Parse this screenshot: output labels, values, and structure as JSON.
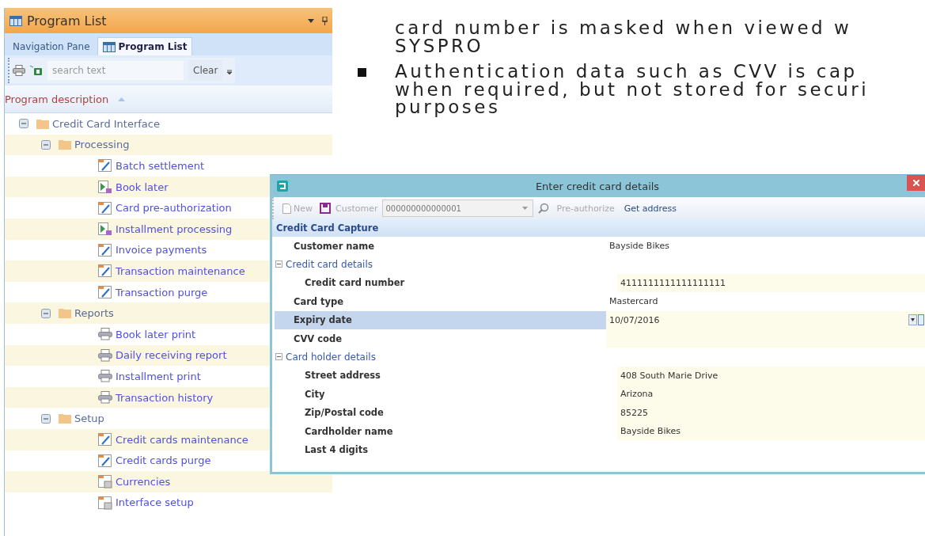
{
  "slide": {
    "bullets": [
      {
        "marker": false,
        "lines": [
          "card number is masked when viewed w",
          "SYSPRO"
        ]
      },
      {
        "marker": true,
        "lines": [
          "Authentication data such as CVV is cap",
          "when required, but not stored for securi",
          "purposes"
        ]
      }
    ]
  },
  "program_list": {
    "title": "Program List",
    "tabs": [
      {
        "label": "Navigation Pane",
        "selected": false,
        "icon": false
      },
      {
        "label": "Program List",
        "selected": true,
        "icon": true
      }
    ],
    "search": {
      "placeholder": "search text"
    },
    "clear_button": "Clear",
    "column": "Program description",
    "tree": [
      {
        "label": "Credit Card Interface",
        "kind": "folder",
        "expanded": true,
        "children": [
          {
            "label": "Processing",
            "kind": "folder",
            "expanded": true,
            "children": [
              {
                "label": "Batch settlement",
                "kind": "form"
              },
              {
                "label": "Book later",
                "kind": "query"
              },
              {
                "label": "Card pre-authorization",
                "kind": "form"
              },
              {
                "label": "Installment processing",
                "kind": "query"
              },
              {
                "label": "Invoice payments",
                "kind": "form"
              },
              {
                "label": "Transaction maintenance",
                "kind": "form"
              },
              {
                "label": "Transaction purge",
                "kind": "form"
              }
            ]
          },
          {
            "label": "Reports",
            "kind": "folder",
            "expanded": true,
            "children": [
              {
                "label": "Book later print",
                "kind": "print"
              },
              {
                "label": "Daily receiving report",
                "kind": "print"
              },
              {
                "label": "Installment print",
                "kind": "print"
              },
              {
                "label": "Transaction history",
                "kind": "print"
              }
            ]
          },
          {
            "label": "Setup",
            "kind": "folder",
            "expanded": true,
            "children": [
              {
                "label": "Credit cards maintenance",
                "kind": "form"
              },
              {
                "label": "Credit cards purge",
                "kind": "form"
              },
              {
                "label": "Currencies",
                "kind": "setup"
              },
              {
                "label": "Interface setup",
                "kind": "setup"
              }
            ]
          }
        ]
      }
    ]
  },
  "dialog": {
    "title": "Enter credit card details",
    "toolbar": [
      {
        "kind": "new",
        "label": "New",
        "disabled": true
      },
      {
        "kind": "save"
      },
      {
        "kind": "label",
        "label": "Customer",
        "disabled": true
      },
      {
        "kind": "combo",
        "value": "000000000000001"
      },
      {
        "kind": "search"
      },
      {
        "kind": "button",
        "label": "Pre-authorize",
        "disabled": true
      },
      {
        "kind": "button",
        "label": "Get address",
        "disabled": false
      }
    ],
    "section": "Credit Card Capture",
    "rows": [
      {
        "kind": "property",
        "label": "Customer name",
        "value": "Bayside Bikes",
        "editable": false,
        "selected": false
      },
      {
        "kind": "category",
        "label": "Credit card details",
        "expanded": true,
        "children": [
          {
            "kind": "property",
            "label": "Credit card number",
            "value": "4111111111111111111",
            "editable": true,
            "selected": false
          }
        ]
      },
      {
        "kind": "property",
        "label": "Card type",
        "value": "Mastercard",
        "editable": false,
        "selected": false
      },
      {
        "kind": "property",
        "label": "Expiry date",
        "value": "10/07/2016",
        "editable": true,
        "selected": true,
        "dropdown": true
      },
      {
        "kind": "property",
        "label": "CVV code",
        "editable": true,
        "selected": false
      },
      {
        "kind": "category",
        "label": "Card holder details",
        "expanded": true,
        "children": [
          {
            "kind": "property",
            "label": "Street address",
            "value": "408 South Marie Drive",
            "editable": true,
            "selected": false
          },
          {
            "kind": "property",
            "label": "City",
            "value": "Arizona",
            "editable": true,
            "selected": false
          },
          {
            "kind": "property",
            "label": "Zip/Postal code",
            "value": "85225",
            "editable": true,
            "selected": false
          },
          {
            "kind": "property",
            "label": "Cardholder name",
            "value": "Bayside Bikes",
            "editable": true,
            "selected": false
          },
          {
            "kind": "property",
            "label": "Last 4 digits",
            "editable": false,
            "selected": false
          }
        ]
      }
    ]
  }
}
